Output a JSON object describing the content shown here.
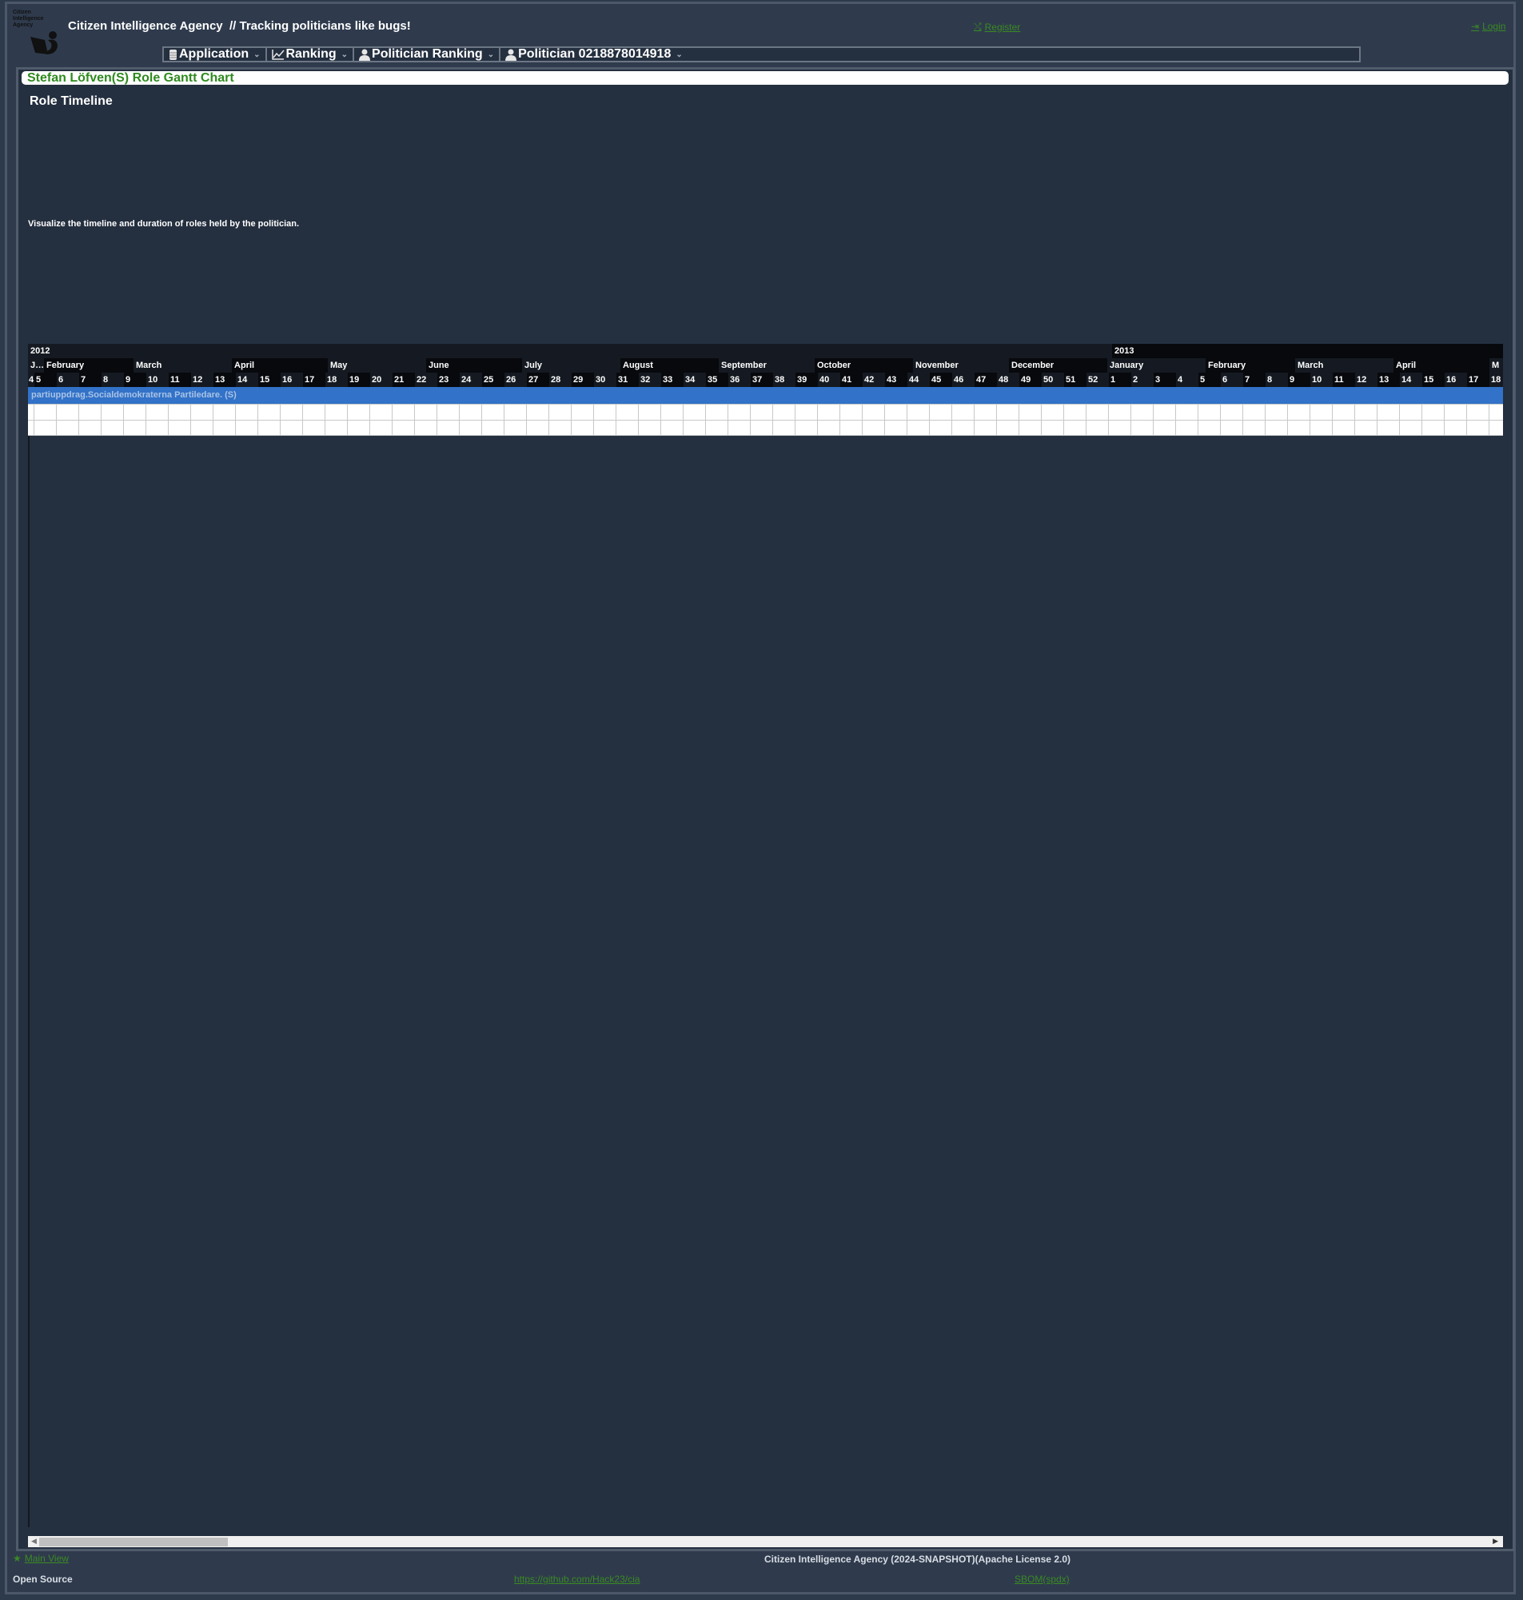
{
  "header": {
    "logo_text": [
      "Citizen",
      "Intelligence",
      "Agency"
    ],
    "app_title": "Citizen Intelligence Agency  // Tracking politicians like bugs!",
    "register_label": "Register",
    "register_icon": "random-icon",
    "login_label": "Login",
    "login_icon": "sign-in-icon"
  },
  "menu": {
    "items": [
      {
        "label": "Application",
        "icon": "database-icon"
      },
      {
        "label": "Ranking",
        "icon": "line-chart-icon"
      },
      {
        "label": "Politician Ranking",
        "icon": "user-icon"
      },
      {
        "label": "Politician 0218878014918",
        "icon": "user-icon"
      }
    ]
  },
  "page": {
    "caption": "Stefan Löfven(S) Role Gantt Chart",
    "section_title": "Role Timeline",
    "section_desc": "Visualize the timeline and duration of roles held by the politician."
  },
  "chart_data": {
    "type": "gantt",
    "title": "Role Timeline",
    "years": [
      {
        "label": "2012",
        "weeks": 48
      },
      {
        "label": "2013",
        "weeks": 18
      }
    ],
    "months": [
      {
        "label": "J…",
        "weeks": 0.5
      },
      {
        "label": "February",
        "weeks": 4
      },
      {
        "label": "March",
        "weeks": 4.4
      },
      {
        "label": "April",
        "weeks": 4.3
      },
      {
        "label": "May",
        "weeks": 4.4
      },
      {
        "label": "June",
        "weeks": 4.3
      },
      {
        "label": "July",
        "weeks": 4.4
      },
      {
        "label": "August",
        "weeks": 4.4
      },
      {
        "label": "September",
        "weeks": 4.3
      },
      {
        "label": "October",
        "weeks": 4.4
      },
      {
        "label": "November",
        "weeks": 4.3
      },
      {
        "label": "December",
        "weeks": 4.4
      },
      {
        "label": "January",
        "weeks": 4.4
      },
      {
        "label": "February",
        "weeks": 4
      },
      {
        "label": "March",
        "weeks": 4.4
      },
      {
        "label": "April",
        "weeks": 4.3
      },
      {
        "label": "M",
        "weeks": 0.5
      }
    ],
    "weeks": [
      "4",
      "5",
      "6",
      "7",
      "8",
      "9",
      "10",
      "11",
      "12",
      "13",
      "14",
      "15",
      "16",
      "17",
      "18",
      "19",
      "20",
      "21",
      "22",
      "23",
      "24",
      "25",
      "26",
      "27",
      "28",
      "29",
      "30",
      "31",
      "32",
      "33",
      "34",
      "35",
      "36",
      "37",
      "38",
      "39",
      "40",
      "41",
      "42",
      "43",
      "44",
      "45",
      "46",
      "47",
      "48",
      "49",
      "50",
      "51",
      "52",
      "1",
      "2",
      "3",
      "4",
      "5",
      "6",
      "7",
      "8",
      "9",
      "10",
      "11",
      "12",
      "13",
      "14",
      "15",
      "16",
      "17",
      "18"
    ],
    "tasks": [
      {
        "label": "partiuppdrag.Socialdemokraterna Partiledare. (S)",
        "color": "#3272c8"
      }
    ],
    "empty_rows": 2
  },
  "scrollbar": {
    "position_fraction": 0.0,
    "visible_fraction": 0.13
  },
  "footer": {
    "main_view_label": "Main View",
    "copyright": "Citizen Intelligence Agency (2024-SNAPSHOT)(Apache License 2.0)",
    "open_source_label": "Open Source",
    "github_link": "https://github.com/Hack23/cia",
    "sbom_link": "SBOM(spdx)"
  }
}
